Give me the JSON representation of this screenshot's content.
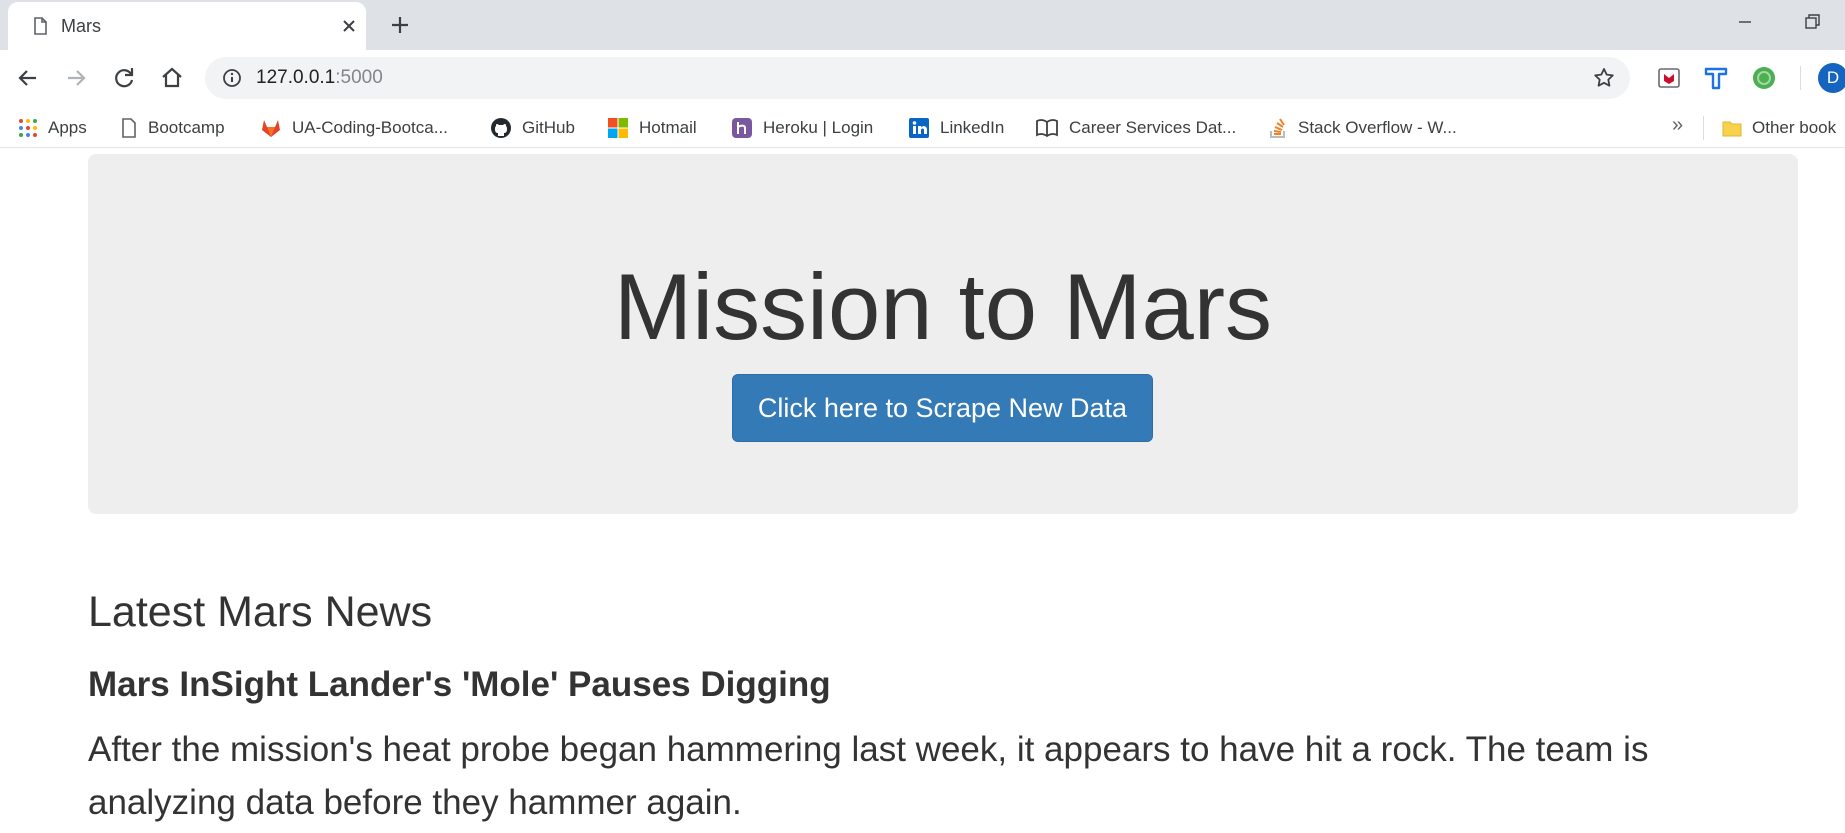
{
  "browser": {
    "tab_title": "Mars",
    "url_host": "127.0.0.1",
    "url_port": ":5000",
    "profile_initial": "D",
    "bookmarks": [
      {
        "label": "Apps",
        "icon": "apps-grid-icon"
      },
      {
        "label": "Bootcamp",
        "icon": "page-icon"
      },
      {
        "label": "UA-Coding-Bootca...",
        "icon": "gitlab-icon"
      },
      {
        "label": "GitHub",
        "icon": "github-icon"
      },
      {
        "label": "Hotmail",
        "icon": "microsoft-icon"
      },
      {
        "label": "Heroku | Login",
        "icon": "heroku-icon"
      },
      {
        "label": "LinkedIn",
        "icon": "linkedin-icon"
      },
      {
        "label": "Career Services Dat...",
        "icon": "book-icon"
      },
      {
        "label": "Stack Overflow - W...",
        "icon": "stackoverflow-icon"
      },
      {
        "label": "Other book",
        "icon": "folder-icon"
      }
    ],
    "overflow_label": "»"
  },
  "jumbotron": {
    "title": "Mission to Mars",
    "button_label": "Click here to Scrape New Data",
    "button_color": "#337ab7"
  },
  "news": {
    "heading": "Latest Mars News",
    "title": "Mars InSight Lander's 'Mole' Pauses Digging",
    "paragraph": "After the mission's heat probe began hammering last week, it appears to have hit a rock. The team is analyzing data before they hammer again."
  }
}
